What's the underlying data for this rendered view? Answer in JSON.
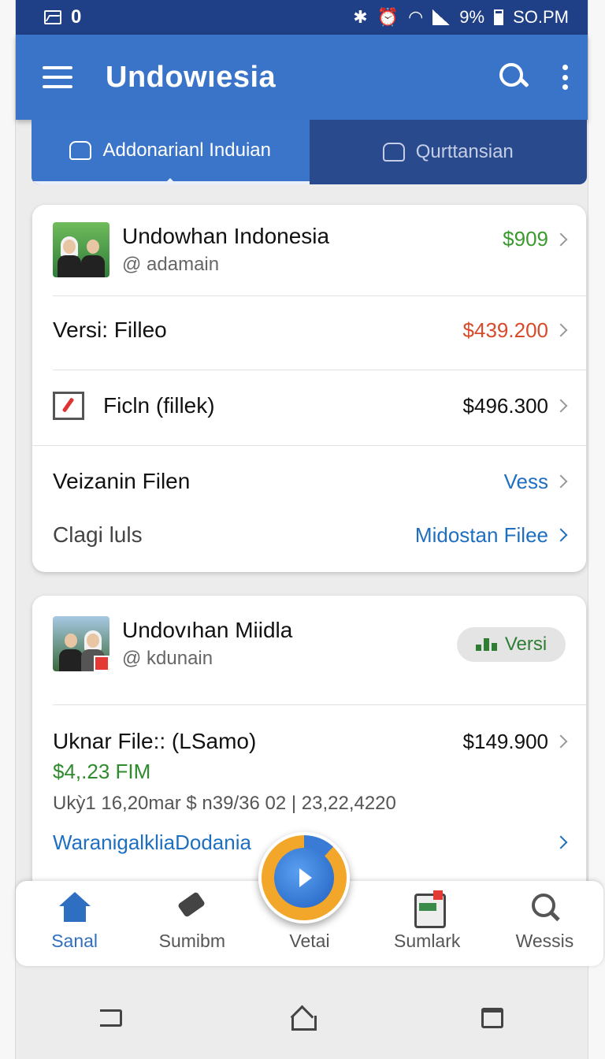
{
  "status_bar": {
    "notification_count": "0",
    "battery": "9%",
    "time": "SO.PM"
  },
  "app_bar": {
    "title": "Undowıesia"
  },
  "tabs": [
    {
      "label": "Addonarianl Induian",
      "active": true
    },
    {
      "label": "Qurttansian",
      "active": false
    }
  ],
  "card1": {
    "name": "Undowhan Indonesia",
    "handle": "@ adamain",
    "price": "$909",
    "rows": [
      {
        "label": "Versi: Filleo",
        "value": "$439.200",
        "color": "#d84a2a"
      },
      {
        "label": "Ficln (fillek)",
        "value": "$496.300",
        "color": "#111111"
      },
      {
        "label": "Veizanin Filen",
        "value": "Vess",
        "color": "#1f6fc0"
      },
      {
        "label": "Clagi luls",
        "value": "Midostan Filee",
        "color": "#1f6fc0"
      }
    ]
  },
  "card2": {
    "name": "Undovıhan Miidla",
    "handle": "@ kdunain",
    "pill": "Versi",
    "file_title": "Uknar File:: (LSamo)",
    "file_price": "$149.900",
    "amount": "$4,.23 FIM",
    "meta": "Ukỳ1 16,20mar $ n39/36 02 | 23,22,4220",
    "link": "WaranigalkliaDodania"
  },
  "bottom_nav": [
    {
      "label": "Sanal",
      "icon": "home-icon",
      "active": true
    },
    {
      "label": "Sumibm",
      "icon": "tag-icon",
      "active": false
    },
    {
      "label": "Vetai",
      "icon": "play-icon",
      "active": false
    },
    {
      "label": "Sumlark",
      "icon": "tablet-icon",
      "active": false
    },
    {
      "label": "Wessis",
      "icon": "search-icon",
      "active": false
    }
  ],
  "colors": {
    "primary": "#3a74c8",
    "dark_primary": "#1f3f86",
    "green": "#3b9a2f",
    "red": "#d84a2a",
    "link": "#1f6fc0"
  }
}
